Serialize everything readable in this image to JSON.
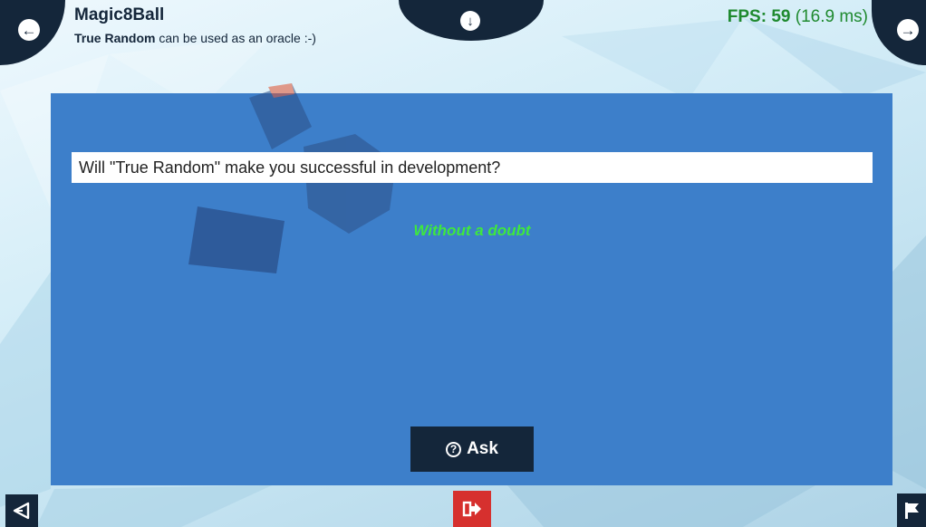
{
  "header": {
    "title": "Magic8Ball",
    "subtitle_bold": "True Random",
    "subtitle_rest": " can be used as an oracle :-)",
    "fps_label": "FPS: 59",
    "fps_ms": " (16.9 ms)"
  },
  "main": {
    "question_value": "Will \"True Random\" make you successful in development?",
    "answer": "Without a doubt",
    "ask_label": "Ask"
  },
  "icons": {
    "prev": "arrow-left-circle-icon",
    "next": "arrow-right-circle-icon",
    "menu": "arrow-down-circle-icon",
    "ask": "question-circle-icon",
    "unity": "unity-logo-icon",
    "exit": "exit-icon",
    "flag": "flag-icon"
  },
  "colors": {
    "dark": "#14263a",
    "panel": "#3d7fca",
    "answer": "#3ee83e",
    "fps": "#1f8a2f",
    "exit": "#d6302e"
  }
}
